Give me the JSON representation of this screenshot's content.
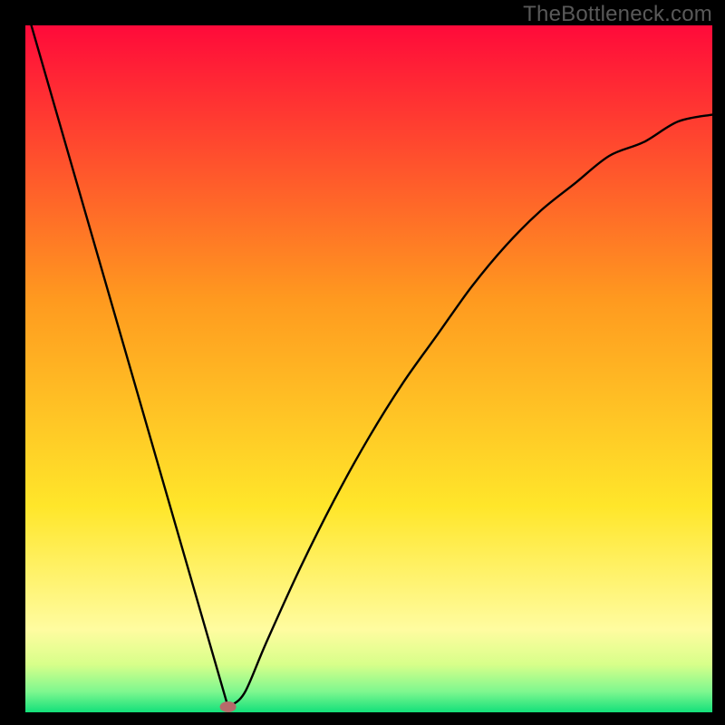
{
  "watermark": "TheBottleneck.com",
  "chart_data": {
    "type": "line",
    "title": "",
    "xlabel": "",
    "ylabel": "",
    "xlim": [
      0,
      1
    ],
    "ylim": [
      0,
      1
    ],
    "grid": false,
    "legend": false,
    "x": [
      0.0,
      0.05,
      0.1,
      0.15,
      0.2,
      0.25,
      0.29,
      0.3,
      0.32,
      0.35,
      0.4,
      0.45,
      0.5,
      0.55,
      0.6,
      0.65,
      0.7,
      0.75,
      0.8,
      0.85,
      0.9,
      0.95,
      1.0
    ],
    "values": [
      1.03,
      0.86,
      0.69,
      0.51,
      0.34,
      0.17,
      0.02,
      0.01,
      0.03,
      0.1,
      0.21,
      0.31,
      0.4,
      0.48,
      0.55,
      0.62,
      0.68,
      0.73,
      0.77,
      0.81,
      0.83,
      0.86,
      0.87
    ],
    "vertex_x": 0.295,
    "vertex_marker_color": "#b76a6a",
    "background_gradient": {
      "stops": [
        {
          "offset": 0.0,
          "color": "#ff0a3a"
        },
        {
          "offset": 0.4,
          "color": "#ff9a1f"
        },
        {
          "offset": 0.7,
          "color": "#ffe62a"
        },
        {
          "offset": 0.88,
          "color": "#fffca0"
        },
        {
          "offset": 0.93,
          "color": "#d8ff8a"
        },
        {
          "offset": 0.97,
          "color": "#7ef78f"
        },
        {
          "offset": 1.0,
          "color": "#13e07a"
        }
      ]
    }
  }
}
